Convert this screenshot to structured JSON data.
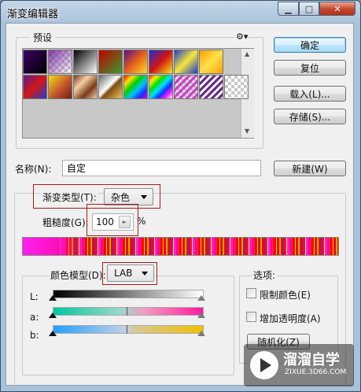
{
  "window": {
    "title": "渐变编辑器",
    "min_glyph": "▁",
    "max_glyph": "□",
    "close_glyph": "✕"
  },
  "presets": {
    "label": "预设",
    "gear_glyph": "⚙▾"
  },
  "buttons": {
    "ok": "确定",
    "reset": "复位",
    "load": "载入(L)...",
    "save": "存储(S)...",
    "new": "新建(W)",
    "randomize": "随机化(Z)"
  },
  "name": {
    "label": "名称(N):",
    "value": "自定"
  },
  "gradient_type": {
    "label": "渐变类型(T):",
    "value": "杂色"
  },
  "roughness": {
    "label": "粗糙度(G):",
    "value": "100",
    "unit": "%"
  },
  "color_model": {
    "label": "颜色模型(D):",
    "value": "LAB",
    "channels": [
      {
        "label": "L:",
        "low": 0,
        "high": 100
      },
      {
        "label": "a:",
        "low": 0,
        "high": 100
      },
      {
        "label": "b:",
        "low": 0,
        "high": 100
      }
    ]
  },
  "options": {
    "label": "选项:",
    "restrict_colors": "限制颜色(E)",
    "add_transparency": "增加透明度(A)"
  },
  "watermark": {
    "brand": "溜溜自学",
    "url": "ZIXUE.3D66.COM"
  },
  "colors": {
    "accent_red": "#b01818",
    "window_frame": "#a9c1d9"
  }
}
